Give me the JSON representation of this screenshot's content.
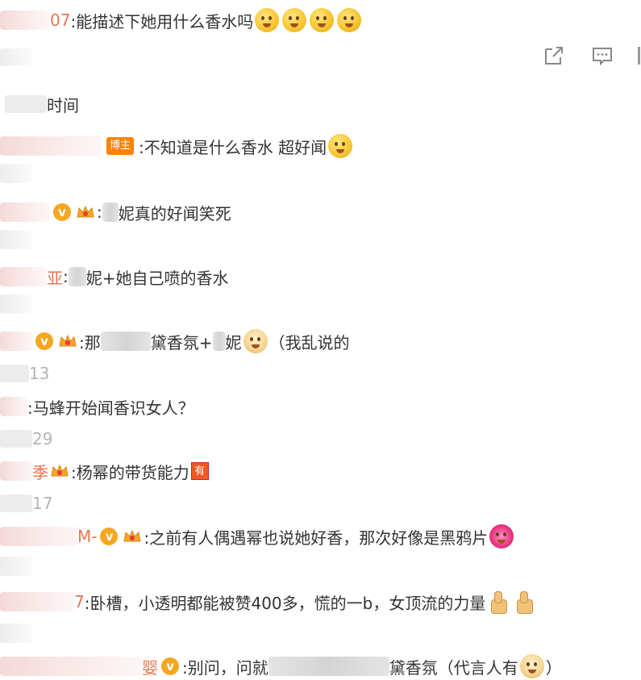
{
  "top_comment": {
    "name_tail": "07",
    "text": ":能描述下她用什么香水吗"
  },
  "actions": {
    "share_icon": "share-icon",
    "comment_icon": "comment-icon"
  },
  "section": {
    "label": "时间"
  },
  "comments": [
    {
      "id": "c1",
      "host_badge": "博主",
      "text": ":不知道是什么香水 超好闻"
    },
    {
      "id": "c2",
      "text_a": ":",
      "text_b": "妮真的好闻笑死"
    },
    {
      "id": "c3",
      "name_tail": "亚",
      "text_a": ":",
      "text_b": "妮+她自己喷的香水"
    },
    {
      "id": "c4",
      "text_a": ":那",
      "text_b": "黛香氛+",
      "text_c": "妮",
      "text_d": "（我乱说的"
    },
    {
      "id": "c5",
      "text": ":马蜂开始闻香识女人？"
    },
    {
      "id": "c6",
      "name_tail": "季",
      "text": ":杨幂的带货能力",
      "you_badge": "有"
    },
    {
      "id": "c7",
      "name_tail": "M-",
      "text": ":之前有人偶遇幂也说她好香，那次好像是黑鸦片"
    },
    {
      "id": "c8",
      "name_tail": "7",
      "text": ":卧槽，小透明都能被赞400多，慌的一b，女顶流的力量"
    },
    {
      "id": "c9",
      "name_tail": "婴",
      "text_a": ":别问，问就",
      "text_b": "黛香氛（代言人有",
      "text_c": "）"
    }
  ],
  "meta": [
    {
      "id": "m4",
      "value": "13"
    },
    {
      "id": "m5",
      "value": "29"
    },
    {
      "id": "m6",
      "value": "17"
    }
  ],
  "colors": {
    "name": "#eb7350",
    "text": "#333333",
    "meta": "#b4b4b4",
    "vip": "#f5a623",
    "host_badge": "#ff8200"
  }
}
